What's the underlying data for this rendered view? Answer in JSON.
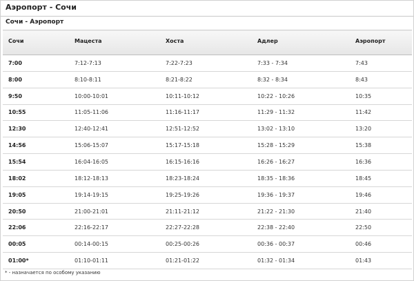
{
  "header": {
    "title": "Аэропорт - Сочи",
    "subtitle": "Сочи - Аэропорт"
  },
  "table": {
    "columns": [
      "Сочи",
      "Мацеста",
      "Хоста",
      "Адлер",
      "Аэропорт"
    ],
    "rows": [
      [
        "7:00",
        "7:12-7:13",
        "7:22-7:23",
        "7:33 - 7:34",
        "7:43"
      ],
      [
        "8:00",
        "8:10-8:11",
        "8:21-8:22",
        "8:32 - 8:34",
        "8:43"
      ],
      [
        "9:50",
        "10:00-10:01",
        "10:11-10:12",
        "10:22 - 10:26",
        "10:35"
      ],
      [
        "10:55",
        "11:05-11:06",
        "11:16-11:17",
        "11:29 - 11:32",
        "11:42"
      ],
      [
        "12:30",
        "12:40-12:41",
        "12:51-12:52",
        "13:02 - 13:10",
        "13:20"
      ],
      [
        "14:56",
        "15:06-15:07",
        "15:17-15:18",
        "15:28 - 15:29",
        "15:38"
      ],
      [
        "15:54",
        "16:04-16:05",
        "16:15-16:16",
        "16:26 - 16:27",
        "16:36"
      ],
      [
        "18:02",
        "18:12-18:13",
        "18:23-18:24",
        "18:35 - 18:36",
        "18:45"
      ],
      [
        "19:05",
        "19:14-19:15",
        "19:25-19:26",
        "19:36 - 19:37",
        "19:46"
      ],
      [
        "20:50",
        "21:00-21:01",
        "21:11-21:12",
        "21:22 - 21:30",
        "21:40"
      ],
      [
        "22:06",
        "22:16-22:17",
        "22:27-22:28",
        "22:38 - 22:40",
        "22:50"
      ],
      [
        "00:05",
        "00:14-00:15",
        "00:25-00:26",
        "00:36 - 00:37",
        "00:46"
      ],
      [
        "01:00*",
        "01:10-01:11",
        "01:21-01:22",
        "01:32 - 01:34",
        "01:43"
      ]
    ]
  },
  "footnote": "* - назначается по особому указанию"
}
